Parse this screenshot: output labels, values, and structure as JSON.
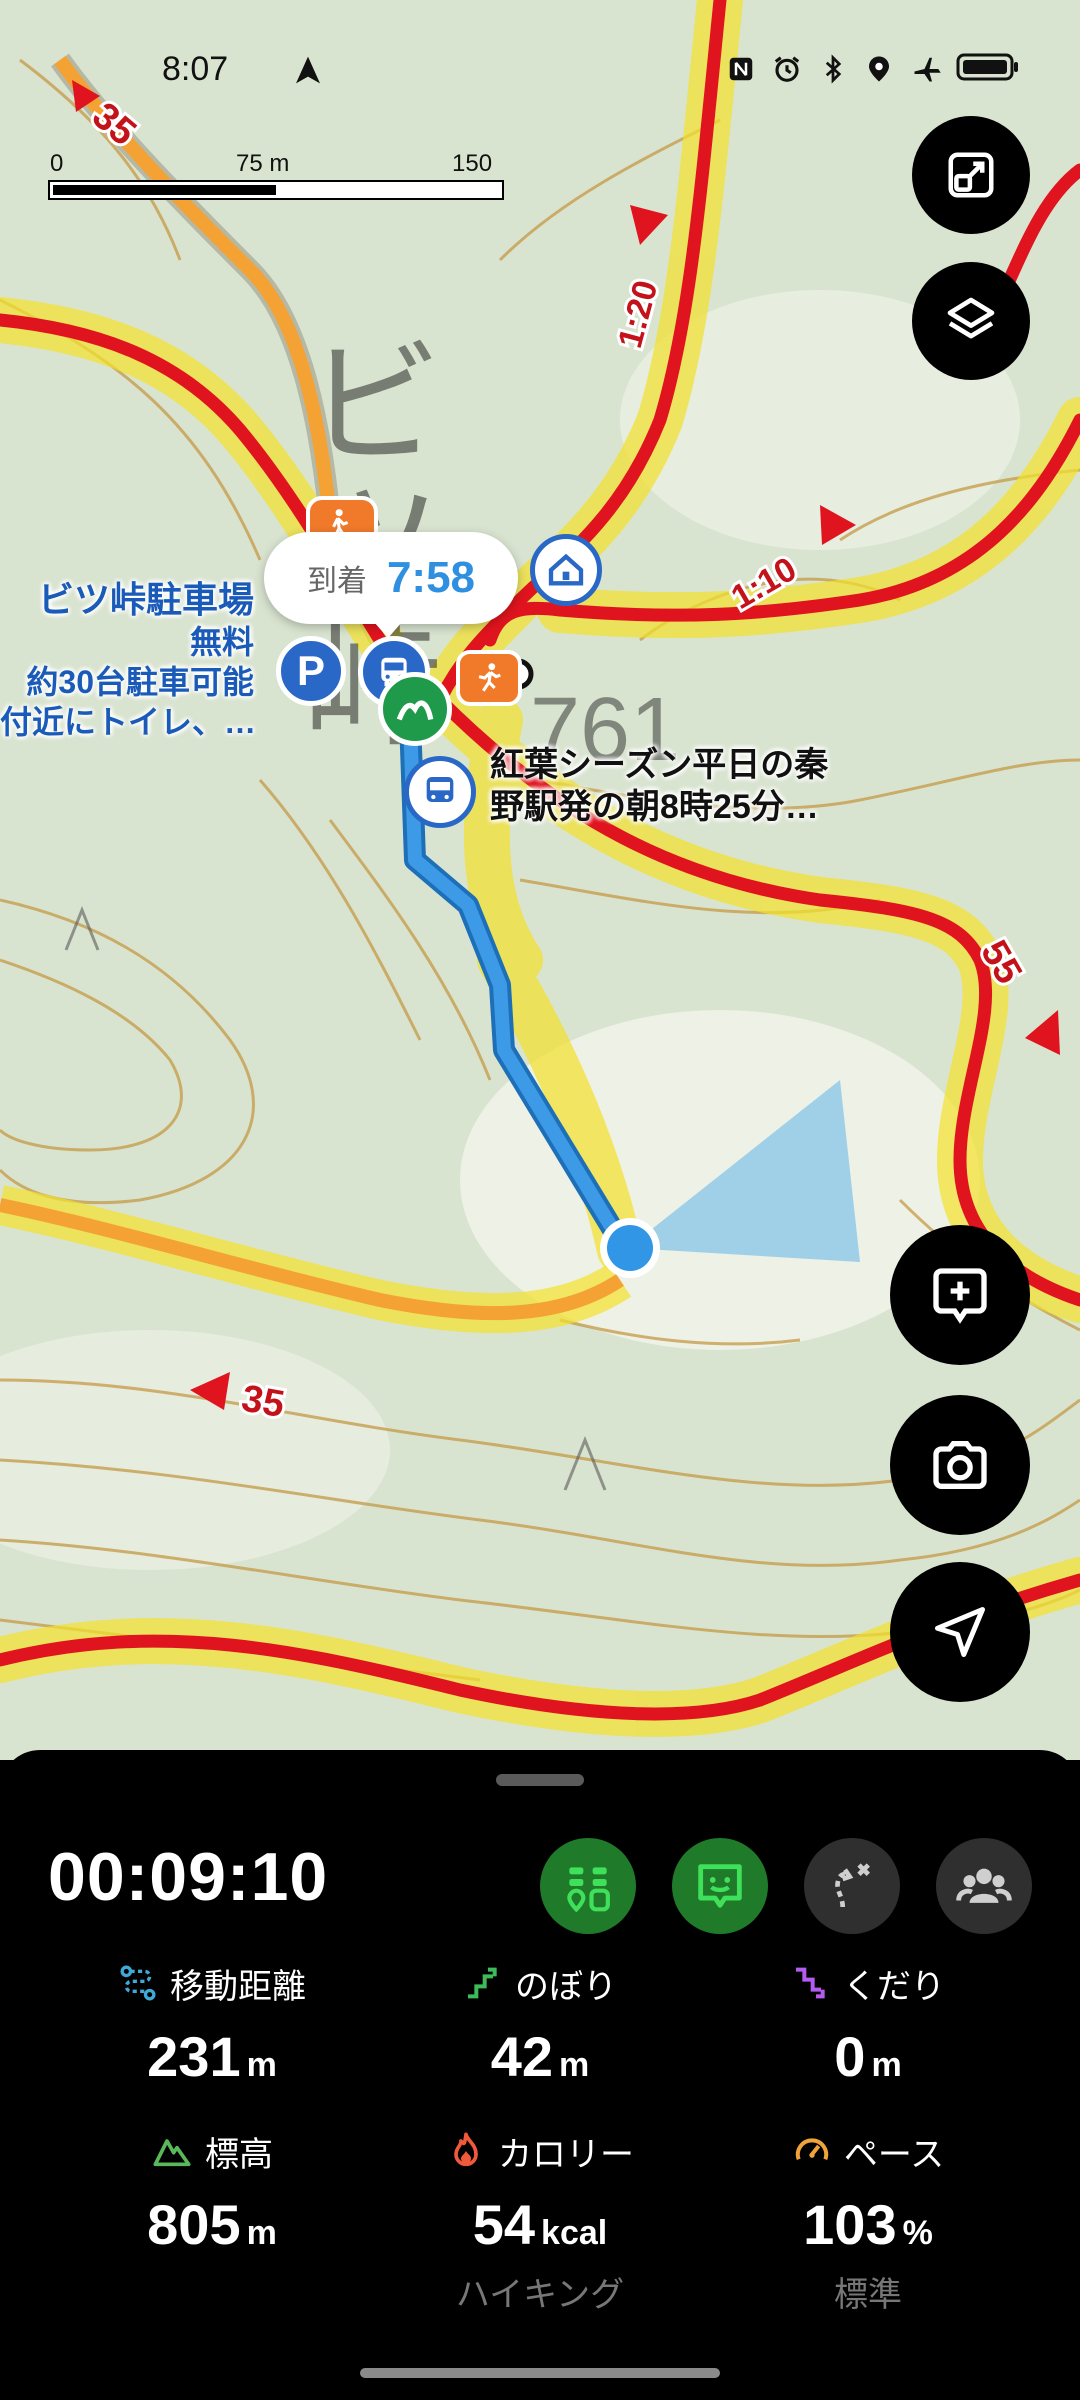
{
  "status_bar": {
    "time": "8:07",
    "icons": [
      "navigation-arrow-icon",
      "nfc-icon",
      "alarm-icon",
      "bluetooth-icon",
      "location-icon",
      "airplane-mode-icon",
      "battery-icon"
    ]
  },
  "map": {
    "scale": {
      "start": "0",
      "mid": "75 m",
      "end": "150 m"
    },
    "place_name": "ビツ峠",
    "elevation_mark": "761",
    "route_times": [
      "1:20",
      "1:10"
    ],
    "road_numbers": [
      "35",
      "35",
      "55"
    ],
    "arrival": {
      "label": "到着",
      "time": "7:58"
    },
    "parking_label": {
      "line1": "ビツ峠駐車場",
      "line2": "無料",
      "line3": "約30台駐車可能",
      "line4": "付近にトイレ、…"
    },
    "bus_note": {
      "line1": "紅葉シーズン平日の秦",
      "line2": "野駅発の朝8時25分…"
    },
    "parking_symbol": "P",
    "colors": {
      "route": "#2f8fe0",
      "trail_red": "#e0141e",
      "trail_yellow": "#f3e12a",
      "contour": "#c79a3a"
    }
  },
  "map_controls": [
    "fullscreen-toggle-icon",
    "layers-icon",
    "add-memo-icon",
    "camera-icon",
    "current-location-icon"
  ],
  "panel": {
    "elapsed_time": "00:09:10",
    "stats": [
      {
        "label": "移動距離",
        "value": "231",
        "unit": "m",
        "icon": "distance-icon",
        "icon_color": "#3fa9d8"
      },
      {
        "label": "のぼり",
        "value": "42",
        "unit": "m",
        "icon": "ascent-icon",
        "icon_color": "#3dbb5a"
      },
      {
        "label": "くだり",
        "value": "0",
        "unit": "m",
        "icon": "descent-icon",
        "icon_color": "#b45cf0"
      },
      {
        "label": "標高",
        "value": "805",
        "unit": "m",
        "icon": "mountain-icon",
        "icon_color": "#58b85a"
      },
      {
        "label": "カロリー",
        "value": "54",
        "unit": "kcal",
        "icon": "flame-icon",
        "icon_color": "#f05a3a",
        "sub": "ハイキング"
      },
      {
        "label": "ペース",
        "value": "103",
        "unit": "%",
        "icon": "speedometer-icon",
        "icon_color": "#f0a33a",
        "sub": "標準"
      }
    ]
  }
}
